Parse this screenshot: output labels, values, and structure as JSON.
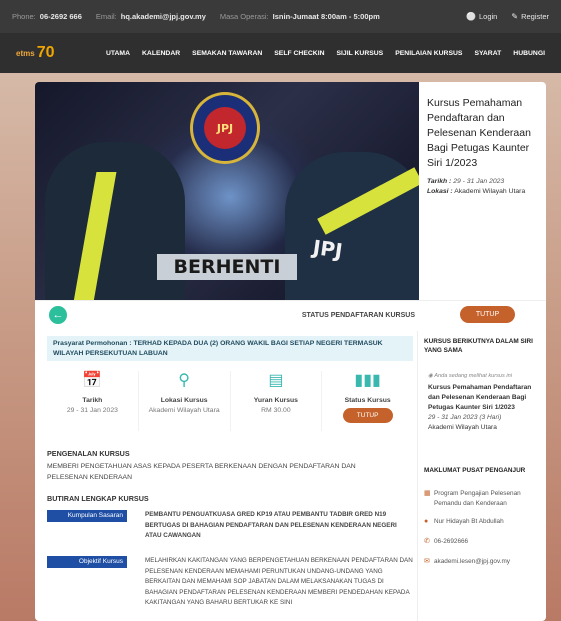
{
  "topbar": {
    "phone_label": "Phone:",
    "phone_value": "06-2692 666",
    "email_label": "Email:",
    "email_value": "hq.akademi@jpj.gov.my",
    "hours_label": "Masa Operasi:",
    "hours_value": "Isnin-Jumaat 8:00am - 5:00pm",
    "login": "Login",
    "register": "Register"
  },
  "nav": {
    "logo_text": "etms",
    "logo_number": "70",
    "items": [
      "UTAMA",
      "KALENDAR",
      "SEMAKAN TAWARAN",
      "SELF CHECKIN",
      "SIJIL KURSUS",
      "PENILAIAN KURSUS",
      "SYARAT",
      "HUBUNGI"
    ]
  },
  "hero": {
    "emblem_text": "JPJ",
    "sign_text": "BERHENTI",
    "vest_text": "JPJ"
  },
  "course": {
    "title": "Kursus Pemahaman Pendaftaran dan Pelesenan Kenderaan Bagi Petugas Kaunter Siri 1/2023",
    "tarikh_label": "Tarikh :",
    "tarikh_value": "29 - 31 Jan 2023",
    "lokasi_label": "Lokasi :",
    "lokasi_value": "Akademi Wilayah Utara"
  },
  "status": {
    "label": "STATUS PENDAFTARAN KURSUS",
    "button": "TUTUP"
  },
  "prasyarat": {
    "label": "Prasyarat Permohonan :",
    "text": "TERHAD KEPADA DUA (2) ORANG WAKIL BAGI SETIAP NEGERI TERMASUK WILAYAH PERSEKUTUAN LABUAN"
  },
  "stats": [
    {
      "icon": "calendar-icon",
      "heading": "Tarikh",
      "value": "29 - 31 Jan 2023"
    },
    {
      "icon": "location-icon",
      "heading": "Lokasi Kursus",
      "value": "Akademi Wilayah Utara"
    },
    {
      "icon": "money-icon",
      "heading": "Yuran Kursus",
      "value": "RM 30.00"
    },
    {
      "icon": "signal-icon",
      "heading": "Status Kursus",
      "value": "TUTUP"
    }
  ],
  "intro": {
    "heading": "PENGENALAN KURSUS",
    "text": "MEMBERI PENGETAHUAN ASAS KEPADA PESERTA BERKENAAN DENGAN PENDAFTARAN DAN PELESENAN KENDERAAN"
  },
  "details": {
    "heading": "BUTIRAN LENGKAP KURSUS",
    "target_label": "Kumpulan Sasaran",
    "target_text": "PEMBANTU PENGUATKUASA GRED KP19 ATAU PEMBANTU TADBIR GRED N19 BERTUGAS DI BAHAGIAN PENDAFTARAN DAN PELESENAN KENDERAAN NEGERI ATAU CAWANGAN",
    "objective_label": "Objektif Kursus",
    "objective_text": "MELAHIRKAN KAKITANGAN YANG BERPENGETAHUAN BERKENAAN PENDAFTARAN DAN  PELESENAN KENDERAAN MEMAHAMI PERUNTUKAN UNDANG-UNDANG YANG BERKAITAN DAN MEMAHAMI SOP JABATAN DALAM MELAKSANAKAN TUGAS DI BAHAGIAN PENDAFTARAN PELESENAN KENDERAAN MEMBERI PENDEDAHAN KEPADA KAKITANGAN YANG BAHARU BERTUKAR KE SINI"
  },
  "sidebar": {
    "next_heading": "KURSUS BERIKUTNYA DALAM SIRI YANG SAMA",
    "note": "Anda sedang melihat kursus ini",
    "next_title": "Kursus Pemahaman Pendaftaran dan Pelesenan Kenderaan Bagi Petugas Kaunter Siri 1/2023",
    "next_date": "29 - 31 Jan 2023 (3 Hari)",
    "next_location": "Akademi Wilayah Utara",
    "organizer_heading": "MAKLUMAT PUSAT PENGANJUR",
    "organizer_program": "Program Pengajian Pelesenan Pemandu dan Kenderaan",
    "organizer_person": "Nur Hidayah Bt Abdullah",
    "organizer_phone": "06-2692666",
    "organizer_email": "akademi.lesen@jpj.gov.my"
  }
}
